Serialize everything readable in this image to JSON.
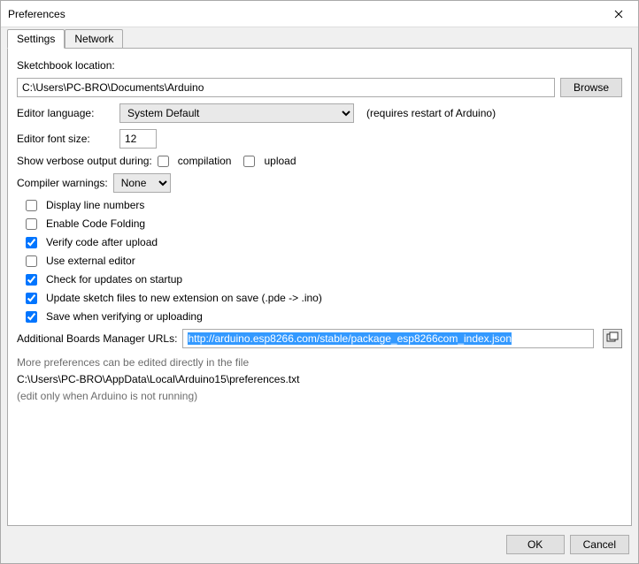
{
  "window": {
    "title": "Preferences"
  },
  "tabs": {
    "settings": "Settings",
    "network": "Network"
  },
  "sketchbook": {
    "label": "Sketchbook location:",
    "value": "C:\\Users\\PC-BRO\\Documents\\Arduino",
    "browse": "Browse"
  },
  "language": {
    "label": "Editor language:",
    "value": "System Default",
    "note": "(requires restart of Arduino)"
  },
  "fontsize": {
    "label": "Editor font size:",
    "value": "12"
  },
  "verbose": {
    "label": "Show verbose output during:",
    "compilation": "compilation",
    "upload": "upload",
    "compilation_checked": false,
    "upload_checked": false
  },
  "warnings": {
    "label": "Compiler warnings:",
    "value": "None"
  },
  "checks": {
    "line_numbers": {
      "label": "Display line numbers",
      "checked": false
    },
    "code_folding": {
      "label": "Enable Code Folding",
      "checked": false
    },
    "verify_upload": {
      "label": "Verify code after upload",
      "checked": true
    },
    "external_editor": {
      "label": "Use external editor",
      "checked": false
    },
    "check_updates": {
      "label": "Check for updates on startup",
      "checked": true
    },
    "update_sketch": {
      "label": "Update sketch files to new extension on save (.pde -> .ino)",
      "checked": true
    },
    "save_verify": {
      "label": "Save when verifying or uploading",
      "checked": true
    }
  },
  "urls": {
    "label": "Additional Boards Manager URLs:",
    "value": "http://arduino.esp8266.com/stable/package_esp8266com_index.json"
  },
  "notes": {
    "more": "More preferences can be edited directly in the file",
    "path": "C:\\Users\\PC-BRO\\AppData\\Local\\Arduino15\\preferences.txt",
    "edit_only": "(edit only when Arduino is not running)"
  },
  "buttons": {
    "ok": "OK",
    "cancel": "Cancel"
  }
}
